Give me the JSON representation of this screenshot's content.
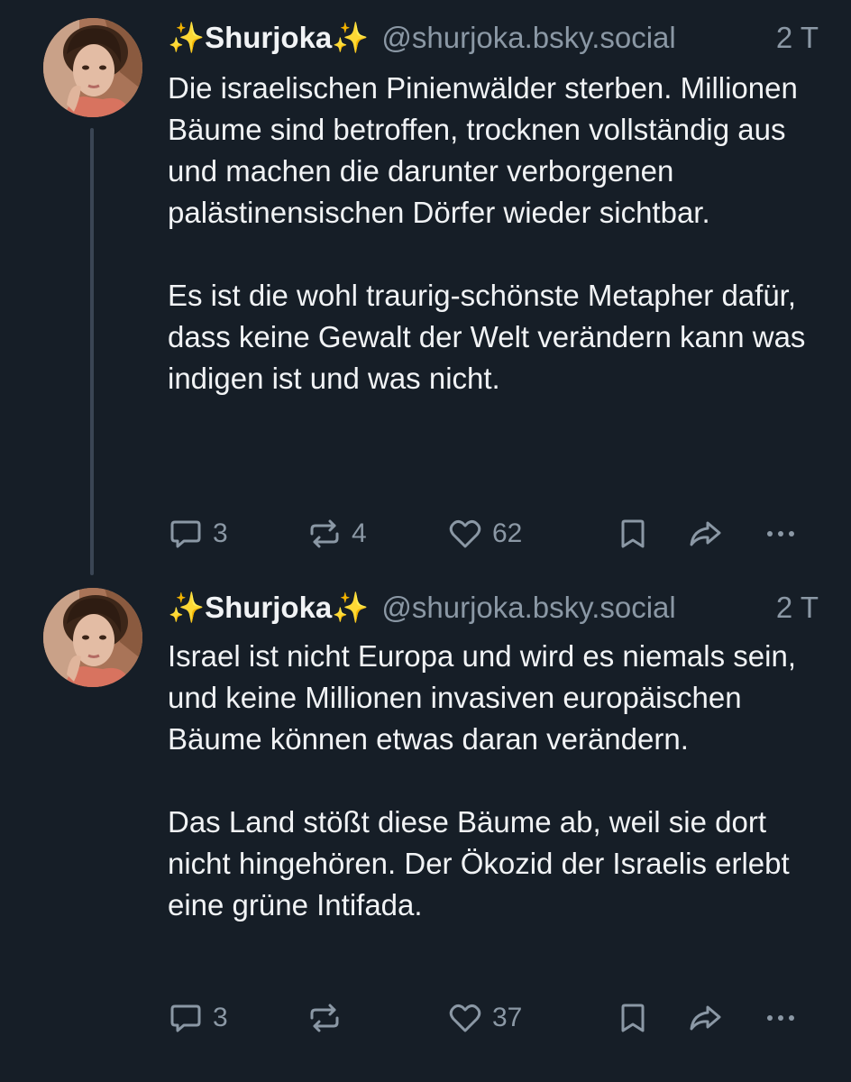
{
  "posts": [
    {
      "author": {
        "display_name": "✨Shurjoka✨",
        "handle": "@shurjoka.bsky.social"
      },
      "timestamp": "2 T",
      "paragraphs": [
        "Die israelischen Pinienwälder sterben. Millionen Bäume sind betroffen, trocknen vollständig aus und machen die darunter verborgenen palästinensischen Dörfer wieder sichtbar.",
        "Es ist die wohl traurig-schönste Metapher dafür, dass keine Gewalt der Welt verändern kann was indigen ist und was nicht."
      ],
      "actions": {
        "replies": "3",
        "reposts": "4",
        "likes": "62"
      }
    },
    {
      "author": {
        "display_name": "✨Shurjoka✨",
        "handle": "@shurjoka.bsky.social"
      },
      "timestamp": "2 T",
      "paragraphs": [
        "Israel ist nicht Europa und wird es niemals sein, und keine Millionen invasiven europäischen Bäume können etwas daran verändern.",
        "Das Land stößt diese Bäume ab, weil sie dort nicht hingehören. Der Ökozid der Israelis erlebt eine grüne Intifada."
      ],
      "actions": {
        "replies": "3",
        "reposts": "",
        "likes": "37"
      }
    }
  ],
  "icons": {
    "reply": "reply-icon",
    "repost": "repost-icon",
    "like": "heart-icon",
    "bookmark": "bookmark-icon",
    "share": "share-icon",
    "more": "more-options-icon"
  },
  "colors": {
    "background": "#161e27",
    "text_primary": "#f1f3f5",
    "text_secondary": "#8b98a5",
    "thread_line": "#3a4554"
  }
}
